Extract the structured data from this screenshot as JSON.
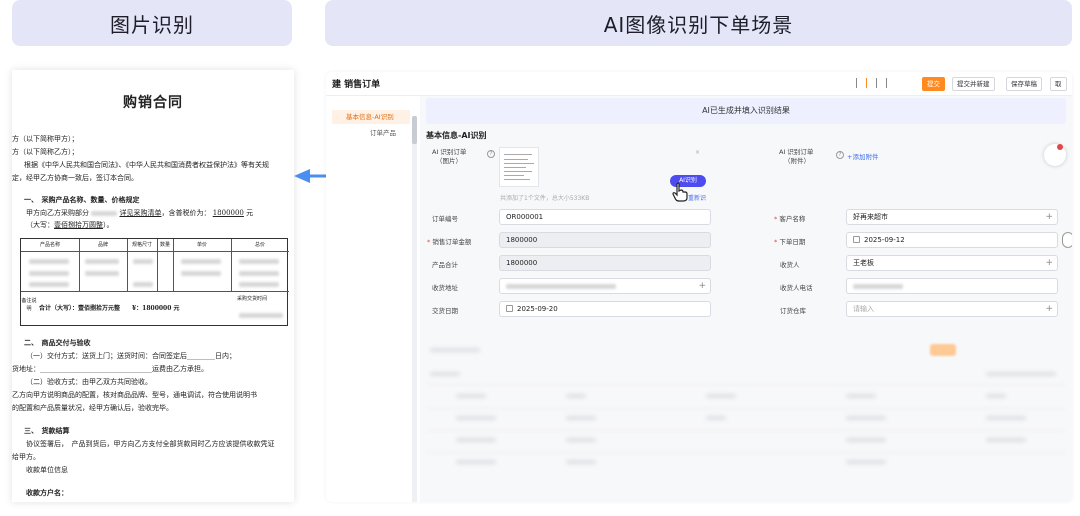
{
  "banners": {
    "left": "图片识别",
    "right": "AI图像识别下单场景"
  },
  "document": {
    "title": "购销合同",
    "party_a": "方（以下简称甲方）；",
    "party_b": "方（以下简称乙方）；",
    "intro1": "根据《中华人民共和国合同法》、《中华人民共和国消费者权益保护法》等有关规",
    "intro2": "定，经甲乙方协商一致后，签订本合同。",
    "sec1": "一、　采购产品名称、数量、价格规定",
    "sec1_line1": "甲方向乙方采购部分",
    "sec1_link": "详见采购清单",
    "sec1_tax": "，含普税价为：",
    "sec1_amount": "1800000",
    "sec1_unit": "元",
    "sec1_caps_label": "（大写：",
    "sec1_caps": "壹佰捌拾万圆整",
    "sec1_caps_end": "）。",
    "table_headers": [
      "产品名称",
      "品牌",
      "规格尺寸",
      "数量",
      "单价",
      "总价"
    ],
    "table_side": "备注说明",
    "table_total": "合计（大写）：壹佰捌拾万元整　　¥：1800000 元",
    "table_time": "采购交货时间",
    "sec2": "二、　商品交付与验收",
    "sec2_l1": "（一）交付方式：送货上门；送货时间：合同签定后________日内；",
    "sec2_l2": "货地址：________________________________运费由乙方承担。",
    "sec2_l3": "（二）验收方式：由甲乙双方共同验收。",
    "sec2_l4": "乙方向甲方说明商品的配置，核对商品品牌、型号，通电调试，符合使用说明书",
    "sec2_l5": "的配置和产品质量状况，经甲方确认后，验收完毕。",
    "sec3": "三、　货款结算",
    "sec3_l1": "协议签署后，　产品到货后，甲方向乙方支付全部货款同时乙方应该提供收款凭证",
    "sec3_l2": "给甲方。",
    "sec3_l3": "收款单位信息",
    "payee": "收款方户名："
  },
  "app": {
    "title": "建 销售订单",
    "toolbar": {
      "submit": "提交",
      "submit_new": "提交并新建",
      "save_draft": "保存草稿",
      "cancel": "取"
    },
    "sidebar": [
      {
        "label": "基本信息-AI识别",
        "active": true
      },
      {
        "label": "订单产品",
        "active": false
      }
    ],
    "notice": "AI已生成并填入识别结果",
    "section_title": "基本信息-AI识别",
    "image_field": {
      "label1": "AI 识别订单",
      "label2": "（图片）"
    },
    "attach_field": {
      "label1": "AI 识别订单",
      "label2": "（附件）",
      "add": "+添加附件"
    },
    "ai_button": "AI识别",
    "upload_hint": "共添加了1个文件，总大小533KB",
    "redo": "重新识",
    "fields": {
      "order_no": {
        "label": "订单编号",
        "value": "OR000001"
      },
      "customer": {
        "label": "客户名称",
        "value": "好再来超市"
      },
      "amount": {
        "label": "销售订单金额",
        "value": "1800000"
      },
      "order_date": {
        "label": "下单日期",
        "value": "2025-09-12"
      },
      "product_total": {
        "label": "产品合计",
        "value": "1800000"
      },
      "receiver": {
        "label": "收货人",
        "value": "王老板"
      },
      "address": {
        "label": "收货地址",
        "value": ""
      },
      "receiver_phone": {
        "label": "收货人电话",
        "value": ""
      },
      "delivery_date": {
        "label": "交货日期",
        "value": "2025-09-20"
      },
      "warehouse": {
        "label": "订货仓库",
        "placeholder": "请输入"
      }
    }
  },
  "colors": {
    "accent_orange": "#ff8a1f",
    "ai_purple": "#4c4cf0",
    "arrow_blue": "#4a8ef0",
    "banner_bg": "#e4e6f8"
  }
}
